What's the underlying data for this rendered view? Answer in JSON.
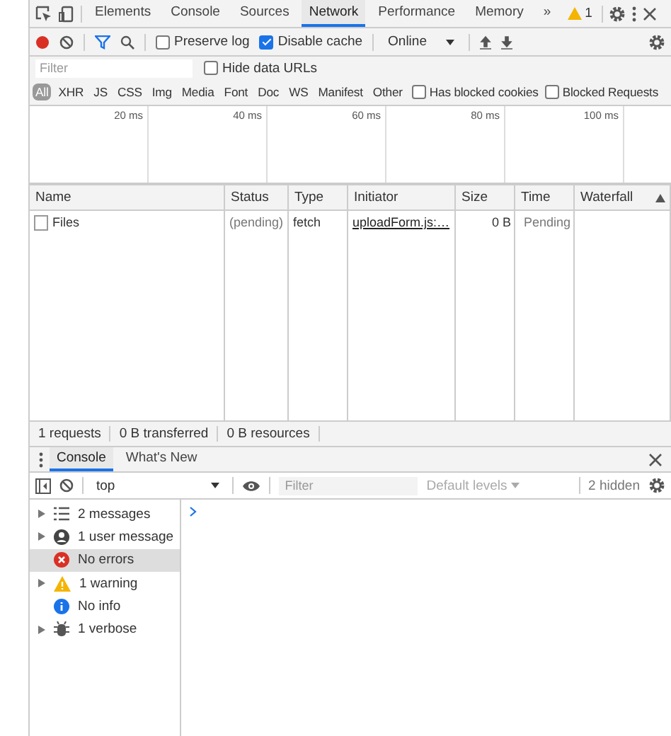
{
  "main_tabs": [
    {
      "label": "Elements",
      "selected": false
    },
    {
      "label": "Console",
      "selected": false
    },
    {
      "label": "Sources",
      "selected": false
    },
    {
      "label": "Network",
      "selected": true
    },
    {
      "label": "Performance",
      "selected": false
    },
    {
      "label": "Memory",
      "selected": false
    }
  ],
  "overflow": "»",
  "warning_count": "1",
  "toolbar": {
    "recording": true,
    "preserve_log": {
      "label": "Preserve log",
      "checked": false
    },
    "disable_cache": {
      "label": "Disable cache",
      "checked": true
    },
    "throttling": "Online"
  },
  "filter": {
    "placeholder": "Filter"
  },
  "hide_data_urls": {
    "label": "Hide data URLs",
    "checked": false
  },
  "type_filters": [
    {
      "label": "All",
      "selected": true
    },
    {
      "label": "XHR",
      "selected": false
    },
    {
      "label": "JS",
      "selected": false
    },
    {
      "label": "CSS",
      "selected": false
    },
    {
      "label": "Img",
      "selected": false
    },
    {
      "label": "Media",
      "selected": false
    },
    {
      "label": "Font",
      "selected": false
    },
    {
      "label": "Doc",
      "selected": false
    },
    {
      "label": "WS",
      "selected": false
    },
    {
      "label": "Manifest",
      "selected": false
    },
    {
      "label": "Other",
      "selected": false
    }
  ],
  "has_blocked_cookies": {
    "label": "Has blocked cookies",
    "checked": false
  },
  "blocked_requests": {
    "label": "Blocked Requests",
    "checked": false
  },
  "timeline_ticks": [
    "20 ms",
    "40 ms",
    "60 ms",
    "80 ms",
    "100 ms"
  ],
  "table": {
    "columns": [
      {
        "label": "Name",
        "sorted": false
      },
      {
        "label": "Status",
        "sorted": false
      },
      {
        "label": "Type",
        "sorted": false
      },
      {
        "label": "Initiator",
        "sorted": false
      },
      {
        "label": "Size",
        "sorted": false
      },
      {
        "label": "Time",
        "sorted": false
      },
      {
        "label": "Waterfall",
        "sorted": true
      }
    ],
    "rows": [
      {
        "name": "Files",
        "status": "(pending)",
        "type": "fetch",
        "initiator": "uploadForm.js:…",
        "size": "0 B",
        "time": "Pending"
      }
    ]
  },
  "status_bar": [
    "1 requests",
    "0 B transferred",
    "0 B resources"
  ],
  "drawer_tabs": [
    {
      "label": "Console",
      "selected": true
    },
    {
      "label": "What's New",
      "selected": false
    }
  ],
  "console_toolbar": {
    "context": "top",
    "filter_placeholder": "Filter",
    "levels": "Default levels",
    "hidden": "2 hidden"
  },
  "sidebar": [
    {
      "kind": "messages",
      "label": "2 messages",
      "expandable": true,
      "selected": false
    },
    {
      "kind": "user",
      "label": "1 user message",
      "expandable": true,
      "selected": false
    },
    {
      "kind": "error",
      "label": "No errors",
      "expandable": false,
      "selected": true
    },
    {
      "kind": "warning",
      "label": "1 warning",
      "expandable": true,
      "selected": false
    },
    {
      "kind": "info",
      "label": "No info",
      "expandable": false,
      "selected": false
    },
    {
      "kind": "verbose",
      "label": "1 verbose",
      "expandable": true,
      "selected": false
    }
  ]
}
